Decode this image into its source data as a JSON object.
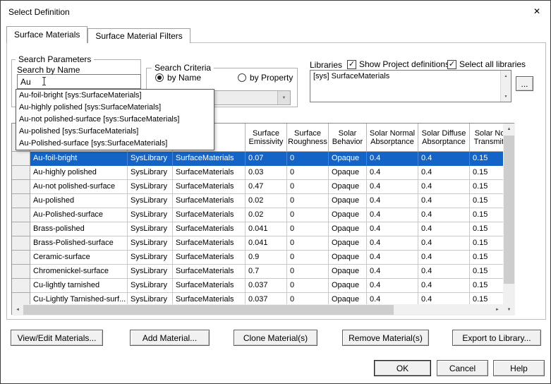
{
  "window": {
    "title": "Select Definition"
  },
  "icons": {
    "close": "✕",
    "check": "✓",
    "up_arrow": "▲",
    "down_arrow": "▼",
    "left_arrow": "◄",
    "right_arrow": "►",
    "combo_arrow": "▼"
  },
  "colors": {
    "selection_blue": "#1464c8"
  },
  "tabs": [
    {
      "label": "Surface Materials",
      "active": true
    },
    {
      "label": "Surface Material Filters",
      "active": false
    }
  ],
  "search_parameters": {
    "group_label": "Search Parameters",
    "field_label": "Search by Name",
    "value": "Au"
  },
  "search_criteria": {
    "group_label": "Search Criteria",
    "options": [
      {
        "label": "by Name",
        "selected": true
      },
      {
        "label": "by Property",
        "selected": false
      }
    ]
  },
  "libraries": {
    "label": "Libraries",
    "checkboxes": [
      {
        "label": "Show Project definitions",
        "checked": true
      },
      {
        "label": "Select all libraries",
        "checked": true
      }
    ],
    "items": [
      "[sys] SurfaceMaterials"
    ],
    "browse_label": "..."
  },
  "autocomplete_items": [
    "Au-foil-bright [sys:SurfaceMaterials]",
    "Au-highly polished [sys:SurfaceMaterials]",
    "Au-not polished-surface [sys:SurfaceMaterials]",
    "Au-polished [sys:SurfaceMaterials]",
    "Au-Polished-surface [sys:SurfaceMaterials]"
  ],
  "table": {
    "columns": [
      {
        "key": "name",
        "header": ""
      },
      {
        "key": "library",
        "header": ""
      },
      {
        "key": "category",
        "header": ""
      },
      {
        "key": "emissivity",
        "header": "Surface Emissivity"
      },
      {
        "key": "roughness",
        "header": "Surface Roughness"
      },
      {
        "key": "behavior",
        "header": "Solar Behavior"
      },
      {
        "key": "normal_absorptance",
        "header": "Solar Normal Absorptance"
      },
      {
        "key": "diffuse_absorptance",
        "header": "Solar Norm Transmittan"
      },
      {
        "key": "normal_transmittance",
        "header": ""
      }
    ],
    "header_labels": {
      "emissivity": "Surface Emissivity",
      "roughness": "Surface Roughness",
      "behavior": "Solar Behavior",
      "normal_absorptance": "Solar Normal Absorptance",
      "diffuse_absorptance": "Solar Diffuse Absorptance",
      "normal_transmittance": "Solar Norm Transmittan"
    },
    "rows": [
      {
        "name": "Au-foil-bright",
        "library": "SysLibrary",
        "category": "SurfaceMaterials",
        "emissivity": "0.07",
        "roughness": "0",
        "behavior": "Opaque",
        "normal_absorptance": "0.4",
        "diffuse_absorptance": "0.4",
        "normal_transmittance": "0.15",
        "selected": true
      },
      {
        "name": "Au-highly polished",
        "library": "SysLibrary",
        "category": "SurfaceMaterials",
        "emissivity": "0.03",
        "roughness": "0",
        "behavior": "Opaque",
        "normal_absorptance": "0.4",
        "diffuse_absorptance": "0.4",
        "normal_transmittance": "0.15",
        "selected": false
      },
      {
        "name": "Au-not polished-surface",
        "library": "SysLibrary",
        "category": "SurfaceMaterials",
        "emissivity": "0.47",
        "roughness": "0",
        "behavior": "Opaque",
        "normal_absorptance": "0.4",
        "diffuse_absorptance": "0.4",
        "normal_transmittance": "0.15",
        "selected": false
      },
      {
        "name": "Au-polished",
        "library": "SysLibrary",
        "category": "SurfaceMaterials",
        "emissivity": "0.02",
        "roughness": "0",
        "behavior": "Opaque",
        "normal_absorptance": "0.4",
        "diffuse_absorptance": "0.4",
        "normal_transmittance": "0.15",
        "selected": false
      },
      {
        "name": "Au-Polished-surface",
        "library": "SysLibrary",
        "category": "SurfaceMaterials",
        "emissivity": "0.02",
        "roughness": "0",
        "behavior": "Opaque",
        "normal_absorptance": "0.4",
        "diffuse_absorptance": "0.4",
        "normal_transmittance": "0.15",
        "selected": false
      },
      {
        "name": "Brass-polished",
        "library": "SysLibrary",
        "category": "SurfaceMaterials",
        "emissivity": "0.041",
        "roughness": "0",
        "behavior": "Opaque",
        "normal_absorptance": "0.4",
        "diffuse_absorptance": "0.4",
        "normal_transmittance": "0.15",
        "selected": false
      },
      {
        "name": "Brass-Polished-surface",
        "library": "SysLibrary",
        "category": "SurfaceMaterials",
        "emissivity": "0.041",
        "roughness": "0",
        "behavior": "Opaque",
        "normal_absorptance": "0.4",
        "diffuse_absorptance": "0.4",
        "normal_transmittance": "0.15",
        "selected": false
      },
      {
        "name": "Ceramic-surface",
        "library": "SysLibrary",
        "category": "SurfaceMaterials",
        "emissivity": "0.9",
        "roughness": "0",
        "behavior": "Opaque",
        "normal_absorptance": "0.4",
        "diffuse_absorptance": "0.4",
        "normal_transmittance": "0.15",
        "selected": false
      },
      {
        "name": "Chromenickel-surface",
        "library": "SysLibrary",
        "category": "SurfaceMaterials",
        "emissivity": "0.7",
        "roughness": "0",
        "behavior": "Opaque",
        "normal_absorptance": "0.4",
        "diffuse_absorptance": "0.4",
        "normal_transmittance": "0.15",
        "selected": false
      },
      {
        "name": "Cu-lightly tarnished",
        "library": "SysLibrary",
        "category": "SurfaceMaterials",
        "emissivity": "0.037",
        "roughness": "0",
        "behavior": "Opaque",
        "normal_absorptance": "0.4",
        "diffuse_absorptance": "0.4",
        "normal_transmittance": "0.15",
        "selected": false
      },
      {
        "name": "Cu-Lightly Tarnished-surf...",
        "library": "SysLibrary",
        "category": "SurfaceMaterials",
        "emissivity": "0.037",
        "roughness": "0",
        "behavior": "Opaque",
        "normal_absorptance": "0.4",
        "diffuse_absorptance": "0.4",
        "normal_transmittance": "0.15",
        "selected": false
      }
    ]
  },
  "action_buttons": [
    "View/Edit Materials...",
    "Add Material...",
    "Clone Material(s)",
    "Remove Material(s)",
    "Export to Library..."
  ],
  "dialog_buttons": [
    "OK",
    "Cancel",
    "Help"
  ]
}
